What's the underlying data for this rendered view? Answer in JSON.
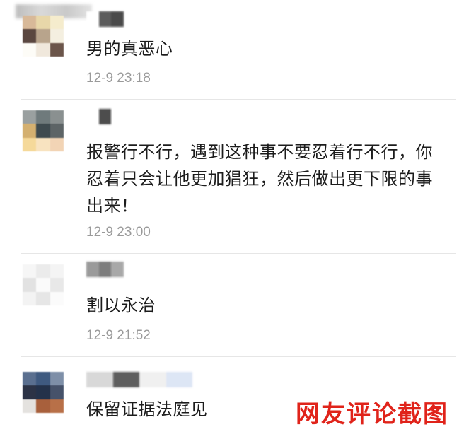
{
  "comments": [
    {
      "text": "男的真恶心",
      "time": "12-9 23:18"
    },
    {
      "text": "报警行不行，遇到这种事不要忍着行不行，你忍着只会让他更加猖狂，然后做出更下限的事出来！",
      "time": "12-9 23:00"
    },
    {
      "text": "割以永治",
      "time": "12-9 21:52"
    },
    {
      "text": "保留证据法庭见",
      "time": ""
    }
  ],
  "watermark": "网友评论截图",
  "colors": {
    "watermark": "#e0231a",
    "timestamp": "#9a9a9a",
    "text": "#1c1c1c",
    "divider": "#e6e6e6"
  }
}
